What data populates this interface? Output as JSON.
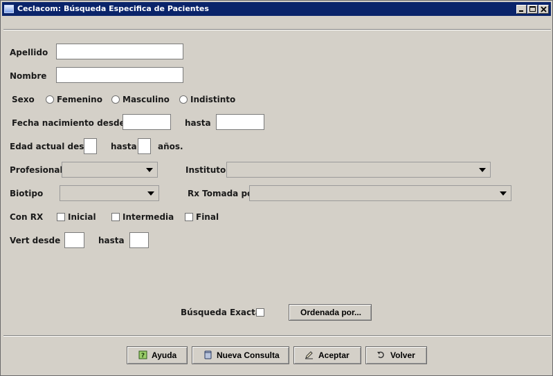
{
  "window": {
    "title": "Ceclacom: Búsqueda Especifica de Pacientes"
  },
  "form": {
    "apellido": {
      "label": "Apellido",
      "value": ""
    },
    "nombre": {
      "label": "Nombre",
      "value": ""
    },
    "sexo": {
      "label": "Sexo",
      "options": [
        "Femenino",
        "Masculino",
        "Indistinto"
      ]
    },
    "fecha": {
      "label": "Fecha nacimiento desde:",
      "hasta_label": "hasta",
      "desde": "",
      "hasta": ""
    },
    "edad": {
      "label": "Edad actual desde",
      "hasta_label": "hasta",
      "unit": "años."
    },
    "profesional": {
      "label": "Profesional",
      "value": ""
    },
    "instituto": {
      "label": "Instituto",
      "value": ""
    },
    "biotipo": {
      "label": "Biotipo",
      "value": ""
    },
    "rx_tomada": {
      "label": "Rx Tomada por",
      "value": ""
    },
    "con_rx": {
      "label": "Con RX",
      "options": [
        "Inicial",
        "Intermedia",
        "Final"
      ]
    },
    "vert": {
      "label": "Vert desde",
      "hasta_label": "hasta"
    },
    "busqueda_exacta": {
      "label": "Búsqueda Exacta"
    },
    "ordenada_por": {
      "label": "Ordenada por..."
    }
  },
  "buttons": {
    "ayuda": "Ayuda",
    "nueva_consulta": "Nueva Consulta",
    "aceptar": "Aceptar",
    "volver": "Volver"
  }
}
